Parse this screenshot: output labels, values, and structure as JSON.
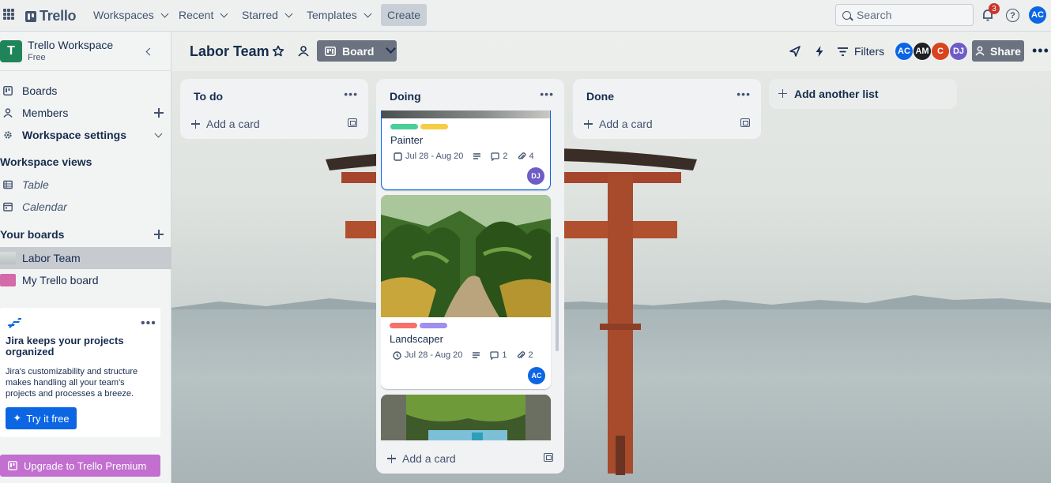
{
  "topnav": {
    "logo": "Trello",
    "menus": [
      "Workspaces",
      "Recent",
      "Starred",
      "Templates"
    ],
    "create_label": "Create",
    "search_placeholder": "Search",
    "notification_count": "3",
    "user_initials": "AC"
  },
  "sidebar": {
    "workspace_initial": "T",
    "workspace_name": "Trello Workspace",
    "workspace_plan": "Free",
    "items": {
      "boards": "Boards",
      "members": "Members",
      "settings": "Workspace settings"
    },
    "views_title": "Workspace views",
    "views": {
      "table": "Table",
      "calendar": "Calendar"
    },
    "boards_title": "Your boards",
    "boards": [
      {
        "name": "Labor Team",
        "color": "#c7cbd0"
      },
      {
        "name": "My Trello board",
        "color": "#d46ba8"
      }
    ],
    "promo": {
      "title": "Jira keeps your projects organized",
      "body": "Jira's customizability and structure makes handling all your team's projects and processes a breeze.",
      "button": "Try it free"
    },
    "upgrade": "Upgrade to Trello Premium"
  },
  "board": {
    "title": "Labor Team",
    "view_label": "Board",
    "filters_label": "Filters",
    "members": [
      {
        "initials": "AC",
        "color": "#0c66e4"
      },
      {
        "initials": "AM",
        "color": "#1d2125"
      },
      {
        "initials": "C",
        "color": "#d9431e"
      },
      {
        "initials": "DJ",
        "color": "#6e5dc6"
      }
    ],
    "share_label": "Share",
    "add_list_label": "Add another list"
  },
  "lists": {
    "todo": {
      "title": "To do",
      "add_card": "Add a card"
    },
    "doing": {
      "title": "Doing",
      "add_card": "Add a card",
      "cards": [
        {
          "title": "Painter",
          "dates": "Jul 28 - Aug 20",
          "comments": "2",
          "attachments": "4",
          "member": "DJ",
          "member_color": "#6e5dc6",
          "labels": [
            "#4bce97",
            "#f5cd47"
          ]
        },
        {
          "title": "Landscaper",
          "dates": "Jul 28 - Aug 20",
          "comments": "1",
          "attachments": "2",
          "member": "AC",
          "member_color": "#0c66e4",
          "labels": [
            "#f87168",
            "#9f8fef"
          ]
        }
      ]
    },
    "done": {
      "title": "Done",
      "add_card": "Add a card"
    }
  }
}
